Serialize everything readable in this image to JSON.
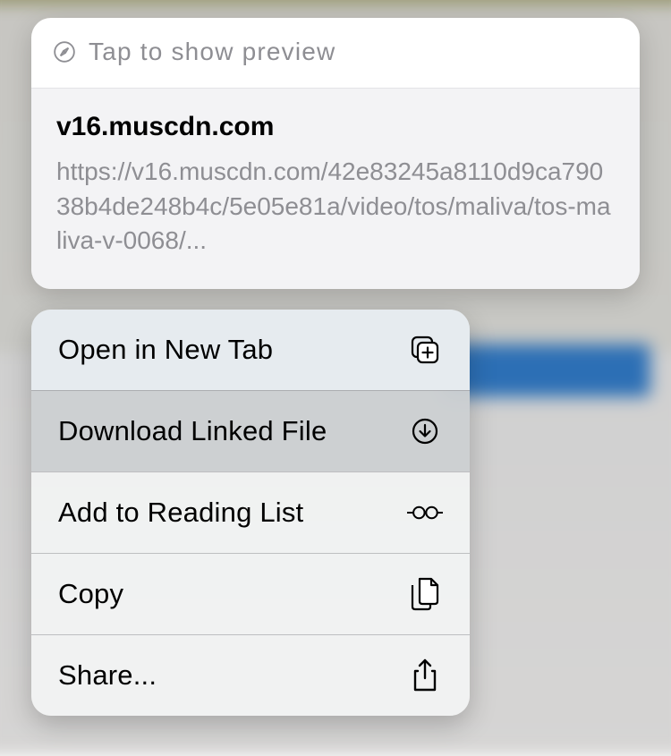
{
  "preview": {
    "hint": "Tap to show preview",
    "domain": "v16.muscdn.com",
    "url": "https://v16.muscdn.com/42e83245a8110d9ca79038b4de248b4c/5e05e81a/video/tos/maliva/tos-maliva-v-0068/..."
  },
  "menu": {
    "open_new_tab": "Open in New Tab",
    "download_linked_file": "Download Linked File",
    "add_reading_list": "Add to Reading List",
    "copy": "Copy",
    "share": "Share..."
  }
}
